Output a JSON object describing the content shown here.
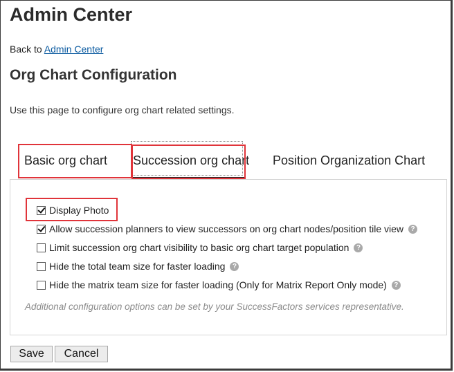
{
  "header": {
    "title": "Admin Center",
    "back_prefix": "Back to ",
    "back_link": "Admin Center"
  },
  "section": {
    "title": "Org Chart Configuration",
    "description": "Use this page to configure org chart related settings."
  },
  "tabs": [
    {
      "label": "Basic org chart",
      "active": false
    },
    {
      "label": "Succession org chart",
      "active": true
    },
    {
      "label": "Position Organization Chart",
      "active": false
    }
  ],
  "options": [
    {
      "label": "Display Photo",
      "checked": true,
      "help": false
    },
    {
      "label": "Allow succession planners to view successors on org chart nodes/position tile view",
      "checked": true,
      "help": true
    },
    {
      "label": "Limit succession org chart visibility to basic org chart target population",
      "checked": false,
      "help": true
    },
    {
      "label": "Hide the total team size for faster loading",
      "checked": false,
      "help": true
    },
    {
      "label": "Hide the matrix team size for faster loading (Only for Matrix Report Only mode)",
      "checked": false,
      "help": true
    }
  ],
  "note": "Additional configuration options can be set by your SuccessFactors services representative.",
  "buttons": {
    "save": "Save",
    "cancel": "Cancel"
  },
  "help_glyph": "?",
  "colors": {
    "annotation": "#e0343a",
    "link": "#0a5aa0",
    "help_icon": "#a9a9a9"
  }
}
